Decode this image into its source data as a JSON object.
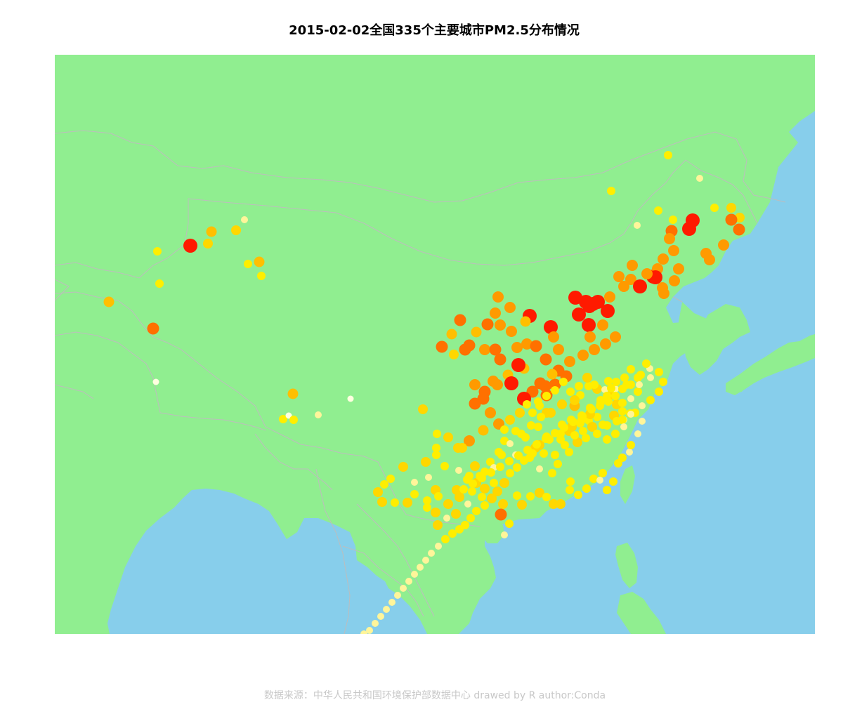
{
  "title": "2015-02-02全国335个主要城市PM2.5分布情况",
  "caption": "数据来源：中华人民共和国环境保护部数据中心 drawed by R author:Conda",
  "colors": {
    "sea": "#87ceeb",
    "land": "#90ee90",
    "border": "#bdbdbd",
    "pm_scale": [
      "#ffffe0",
      "#fff59a",
      "#ffee00",
      "#ffd700",
      "#ffbf00",
      "#ff9a00",
      "#ff7000",
      "#ff4500",
      "#ff1a00"
    ]
  }
}
